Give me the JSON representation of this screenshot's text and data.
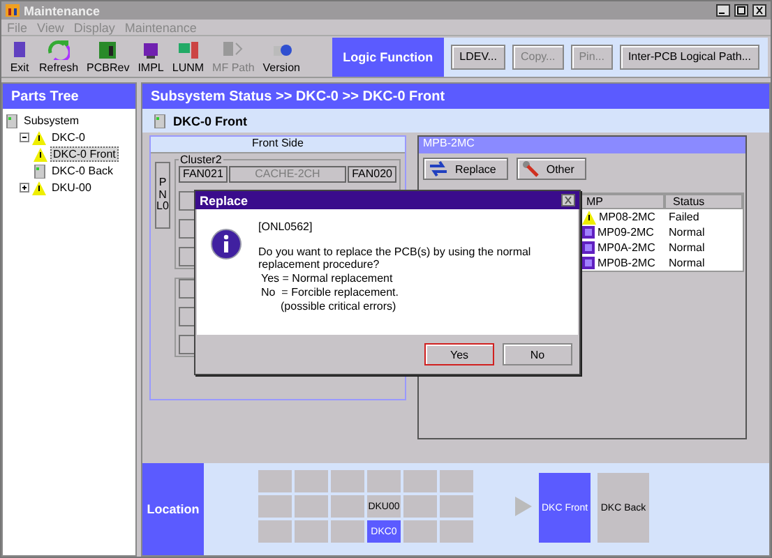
{
  "window": {
    "title": "Maintenance"
  },
  "menu": [
    "File",
    "View",
    "Display",
    "Maintenance"
  ],
  "toolbar": [
    {
      "label": "Exit",
      "disabled": false
    },
    {
      "label": "Refresh",
      "disabled": false
    },
    {
      "label": "PCBRev",
      "disabled": false
    },
    {
      "label": "IMPL",
      "disabled": false
    },
    {
      "label": "LUNM",
      "disabled": false
    },
    {
      "label": "MF Path",
      "disabled": true
    },
    {
      "label": "Version",
      "disabled": false
    }
  ],
  "logic_function": {
    "label": "Logic Function",
    "buttons": [
      {
        "label": "LDEV...",
        "disabled": false
      },
      {
        "label": "Copy...",
        "disabled": true
      },
      {
        "label": "Pin...",
        "disabled": true
      },
      {
        "label": "Inter-PCB Logical Path...",
        "disabled": false
      }
    ]
  },
  "parts_tree": {
    "title": "Parts Tree",
    "items": [
      {
        "label": "Subsystem",
        "kind": "normal",
        "selected": false,
        "children": [
          {
            "label": "DKC-0",
            "kind": "warning",
            "selected": false,
            "expanded": true,
            "children": [
              {
                "label": "DKC-0 Front",
                "kind": "warning",
                "selected": true
              },
              {
                "label": "DKC-0 Back",
                "kind": "normal",
                "selected": false
              }
            ]
          },
          {
            "label": "DKU-00",
            "kind": "warning",
            "selected": false,
            "expanded": false
          }
        ]
      }
    ]
  },
  "breadcrumb": "Subsystem Status >> DKC-0 >> DKC-0 Front",
  "view_title": "DKC-0 Front",
  "front_side": {
    "title": "Front Side",
    "panel_button": "PNL0",
    "cluster": "Cluster2",
    "top_row": [
      {
        "label": "FAN021",
        "disabled": false
      },
      {
        "label": "CACHE-2CH",
        "disabled": true
      },
      {
        "label": "FAN020",
        "disabled": false
      }
    ]
  },
  "mpb_panel": {
    "title": "MPB-2MC",
    "buttons": [
      {
        "label": "Replace"
      },
      {
        "label": "Other"
      }
    ],
    "columns": [
      "MP",
      "Status"
    ],
    "rows": [
      {
        "mp": "MP08-2MC",
        "status": "Failed",
        "kind": "failed"
      },
      {
        "mp": "MP09-2MC",
        "status": "Normal",
        "kind": "normal"
      },
      {
        "mp": "MP0A-2MC",
        "status": "Normal",
        "kind": "normal"
      },
      {
        "mp": "MP0B-2MC",
        "status": "Normal",
        "kind": "normal"
      }
    ]
  },
  "location": {
    "title": "Location",
    "grid": [
      {
        "selected": false
      },
      {
        "selected": false
      },
      {
        "selected": false
      },
      {
        "selected": false
      },
      {
        "selected": false
      },
      {
        "selected": false
      },
      {
        "selected": false
      },
      {
        "selected": false
      },
      {
        "selected": false
      },
      {
        "label": "DKU00",
        "selected": false
      },
      {
        "selected": false
      },
      {
        "selected": false
      },
      {
        "selected": false
      },
      {
        "selected": false
      },
      {
        "selected": false
      },
      {
        "label": "DKC0",
        "selected": true
      },
      {
        "selected": false
      },
      {
        "selected": false
      }
    ],
    "views": [
      {
        "label": "DKC Front",
        "selected": true
      },
      {
        "label": "DKC Back",
        "selected": false
      }
    ]
  },
  "dialog": {
    "title": "Replace",
    "code": "[ONL0562]",
    "message": "Do you want to replace the PCB(s) by using the normal replacement procedure?",
    "options": [
      {
        "text": "Yes = Normal replacement",
        "indent": false
      },
      {
        "text": "No  = Forcible replacement.",
        "indent": false
      },
      {
        "text": "(possible critical errors)",
        "indent": true
      }
    ],
    "buttons": [
      {
        "label": "Yes",
        "default": true
      },
      {
        "label": "No",
        "default": false
      }
    ]
  }
}
